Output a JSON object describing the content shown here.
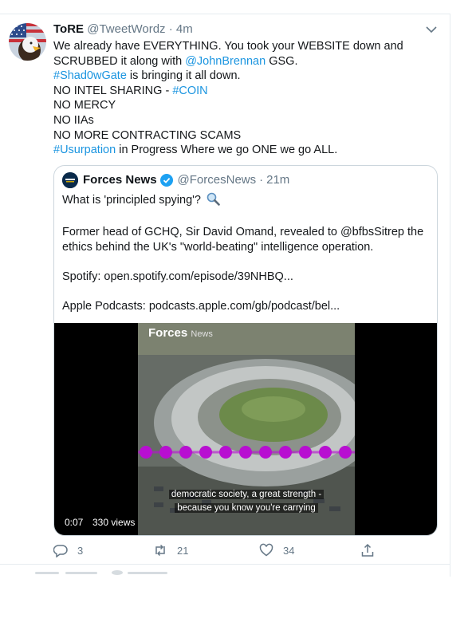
{
  "tweet": {
    "author_name": "ToRE",
    "author_handle": "@TweetWordz",
    "separator": "·",
    "time": "4m",
    "lines": [
      {
        "parts": [
          {
            "text": "We already have EVERYTHING.  You took your WEBSITE down and",
            "link": false
          }
        ]
      },
      {
        "parts": [
          {
            "text": "SCRUBBED it along with ",
            "link": false
          },
          {
            "text": "@JohnBrennan",
            "link": true
          },
          {
            "text": " GSG.",
            "link": false
          }
        ]
      },
      {
        "parts": [
          {
            "text": "#Shad0wGate",
            "link": true
          },
          {
            "text": " is bringing it all down.",
            "link": false
          }
        ]
      },
      {
        "parts": [
          {
            "text": "NO INTEL SHARING - ",
            "link": false
          },
          {
            "text": "#COIN",
            "link": true
          }
        ]
      },
      {
        "parts": [
          {
            "text": "NO MERCY",
            "link": false
          }
        ]
      },
      {
        "parts": [
          {
            "text": "NO IIAs",
            "link": false
          }
        ]
      },
      {
        "parts": [
          {
            "text": "NO MORE CONTRACTING SCAMS",
            "link": false
          }
        ]
      },
      {
        "parts": [
          {
            "text": "#Usurpation",
            "link": true
          },
          {
            "text": " in Progress Where we go ONE we go ALL.",
            "link": false
          }
        ]
      }
    ],
    "actions": {
      "replies": "3",
      "retweets": "21",
      "likes": "34"
    }
  },
  "quote": {
    "name": "Forces News",
    "handle": "@ForcesNews",
    "separator": "·",
    "time": "21m",
    "question": "What is 'principled spying'?",
    "para1_line1": "Former head of GCHQ, Sir David Omand, revealed to @bfbsSitrep the",
    "para1_line2": "ethics behind the UK's \"world-beating\" intelligence operation.",
    "spotify": "Spotify: open.spotify.com/episode/39NHBQ...",
    "apple": "Apple Podcasts: podcasts.apple.com/gb/podcast/bel...",
    "video": {
      "brand": "Forces",
      "brand_suffix": "News",
      "subtitle_line1": "democratic society, a great strength -",
      "subtitle_line2": "because you know you're carrying",
      "timecode": "0:07",
      "views": "330 views"
    }
  },
  "colors": {
    "link": "#1b95e0",
    "muted": "#657786",
    "waveform": "#b80fd1",
    "verified": "#1da1f2"
  },
  "icons": [
    "chevron-down-icon",
    "verified-badge-icon",
    "magnifier-emoji-icon",
    "reply-icon",
    "retweet-icon",
    "like-icon",
    "share-icon"
  ]
}
